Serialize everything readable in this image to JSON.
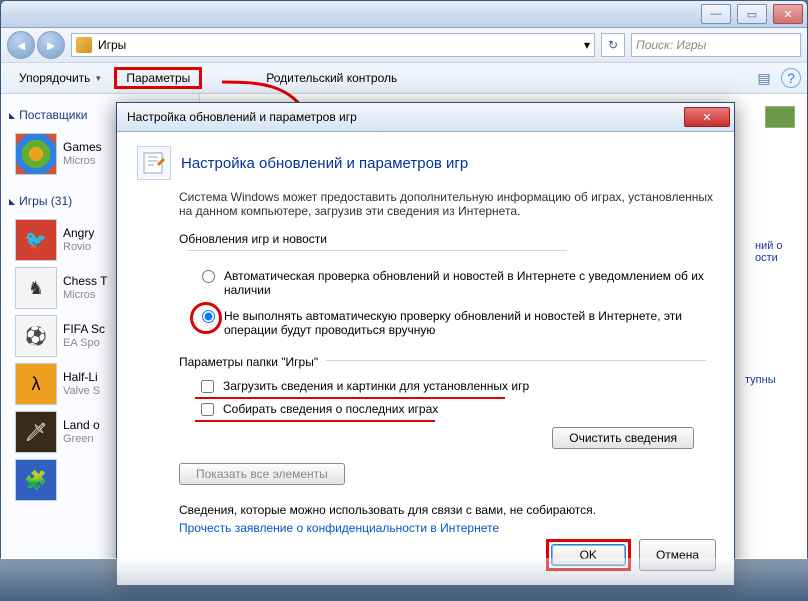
{
  "addressbar": {
    "path": "Игры"
  },
  "search": {
    "placeholder": "Поиск: Игры"
  },
  "toolbar": {
    "organize": "Упорядочить",
    "params": "Параметры",
    "parental": "Родительский контроль"
  },
  "sidebar": {
    "vendors_header": "Поставщики",
    "vendors": [
      {
        "title": "Games",
        "sub": "Micros"
      }
    ],
    "games_header": "Игры (31)",
    "games": [
      {
        "title": "Angry",
        "sub": "Rovio"
      },
      {
        "title": "Chess T",
        "sub": "Micros"
      },
      {
        "title": "FIFA Sc",
        "sub": "EA Spo"
      },
      {
        "title": "Half-Li",
        "sub": "Valve S"
      },
      {
        "title": "Land o",
        "sub": "Green"
      }
    ]
  },
  "content": {
    "side_note1": "ний о\nости",
    "side_note2": "тупны"
  },
  "dialog": {
    "title": "Настройка обновлений и параметров игр",
    "heading": "Настройка обновлений и параметров игр",
    "description": "Система Windows может предоставить дополнительную информацию об играх, установленных на данном компьютере, загрузив эти сведения из Интернета.",
    "group1": "Обновления игр и новости",
    "radio1": "Автоматическая проверка обновлений и новостей в Интернете с уведомлением об их наличии",
    "radio2": "Не выполнять автоматическую проверку обновлений и новостей в Интернете, эти операции будут проводиться вручную",
    "group2": "Параметры папки \"Игры\"",
    "check1": "Загрузить сведения и картинки для установленных игр",
    "check2": "Собирать сведения о последних играх",
    "clear": "Очистить сведения",
    "show_all": "Показать все элементы",
    "info": "Сведения, которые можно использовать для связи с вами, не собираются.",
    "privacy": "Прочесть заявление о конфиденциальности в Интернете",
    "ok": "OK",
    "cancel": "Отмена"
  }
}
